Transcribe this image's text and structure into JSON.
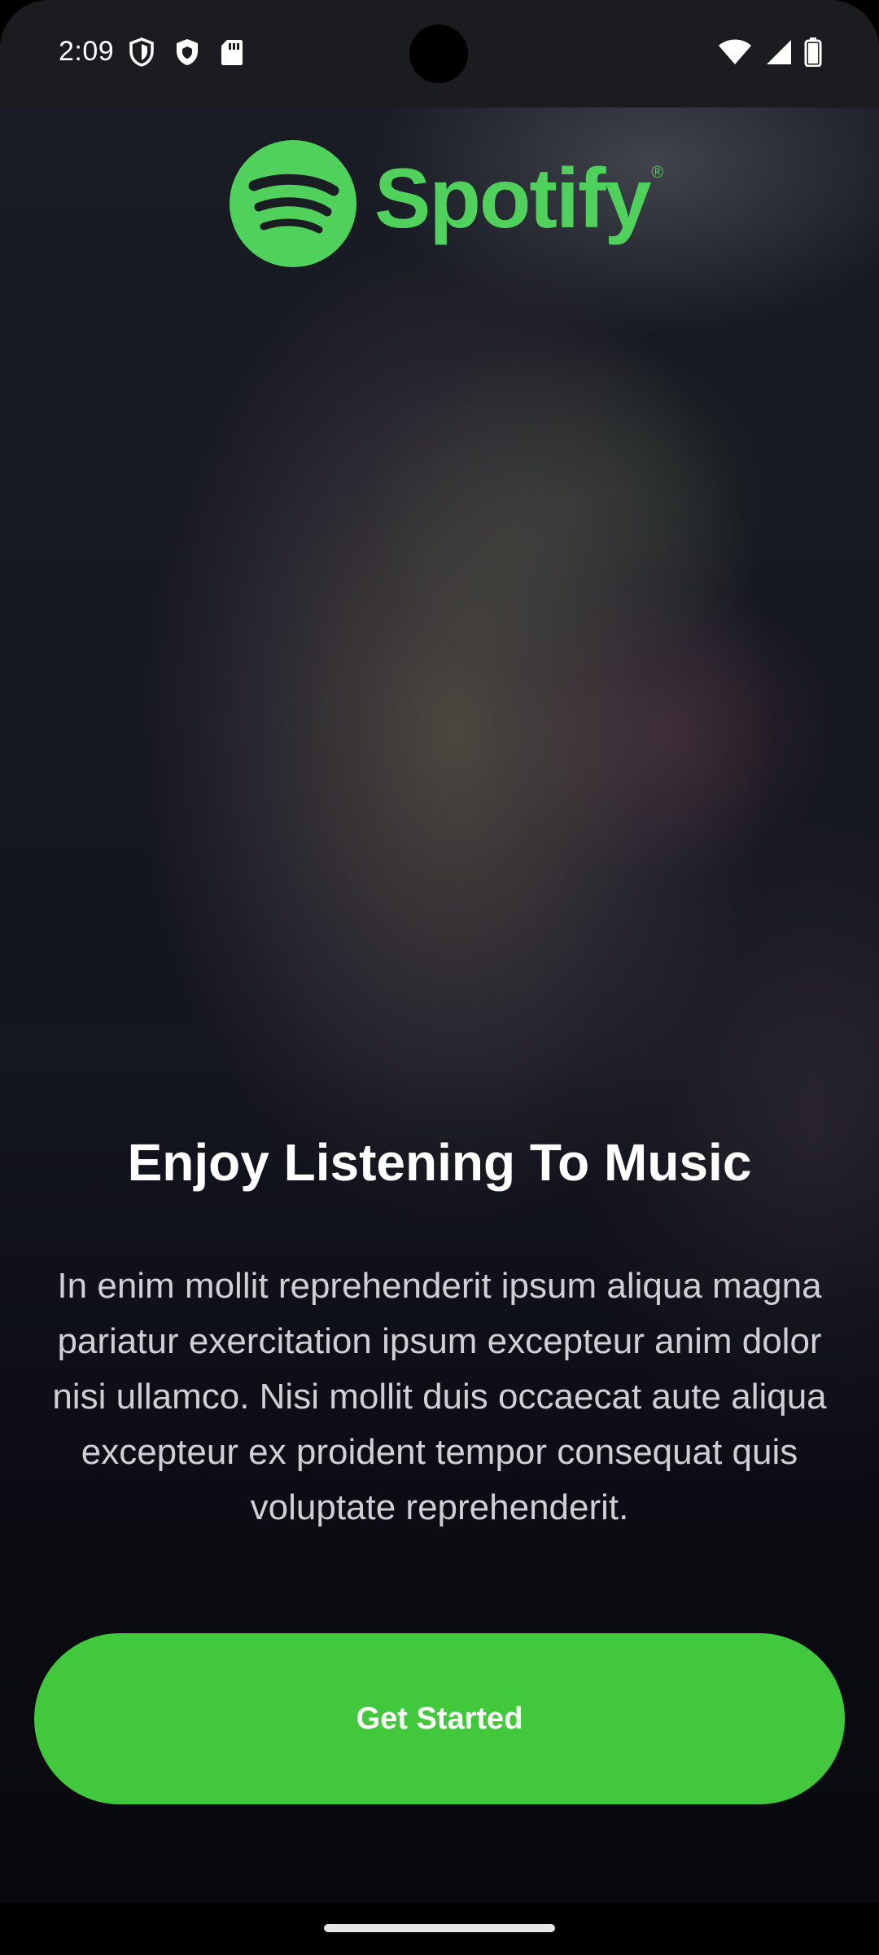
{
  "status_bar": {
    "time": "2:09",
    "left_icons": [
      "shield-outline-icon",
      "shield-filled-icon",
      "sd-card-icon"
    ],
    "right_icons": [
      "wifi-icon",
      "cellular-signal-icon",
      "battery-icon"
    ]
  },
  "brand": {
    "name": "Spotify",
    "registered": "®",
    "color": "#4fd15c"
  },
  "onboarding": {
    "headline": "Enjoy Listening To Music",
    "body": "In enim mollit reprehenderit ipsum aliqua magna pariatur exercitation ipsum excepteur anim dolor nisi ullamco. Nisi mollit duis occaecat aute aliqua excepteur ex proident tempor consequat quis voluptate reprehenderit.",
    "cta_label": "Get Started",
    "cta_color": "#42c83c"
  },
  "colors": {
    "status_bar_bg": "#1b1c20",
    "text_primary": "#ffffff",
    "text_secondary": "#cfcfd4"
  }
}
